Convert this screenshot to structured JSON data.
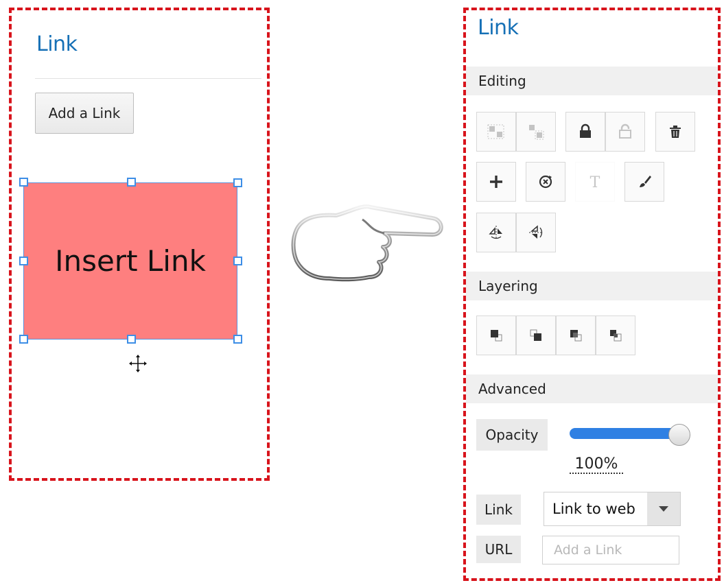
{
  "left_panel": {
    "title": "Link",
    "add_button_label": "Add a Link",
    "shape_text": "Insert Link",
    "shape_color": "#fe7f7f"
  },
  "pointer": {
    "icon": "pointing-hand-icon"
  },
  "right_panel": {
    "title": "Link",
    "sections": {
      "editing": "Editing",
      "layering": "Layering",
      "advanced": "Advanced"
    },
    "editing_tools": [
      "group-icon",
      "ungroup-icon",
      "lock-icon",
      "unlock-icon",
      "delete-icon",
      "add-icon",
      "rotate-icon",
      "text-icon",
      "paint-brush-icon",
      "flip-horizontal-icon",
      "flip-vertical-icon"
    ],
    "layering_tools": [
      "bring-to-front-icon",
      "send-to-back-icon",
      "bring-forward-icon",
      "send-backward-icon"
    ],
    "opacity": {
      "label": "Opacity",
      "value_text": "100%",
      "value": 1.0
    },
    "link": {
      "label": "Link",
      "selected": "Link to web"
    },
    "url": {
      "label": "URL",
      "placeholder": "Add a Link"
    },
    "accent_color": "#2f80e3"
  },
  "frame_color": "#d8141c"
}
